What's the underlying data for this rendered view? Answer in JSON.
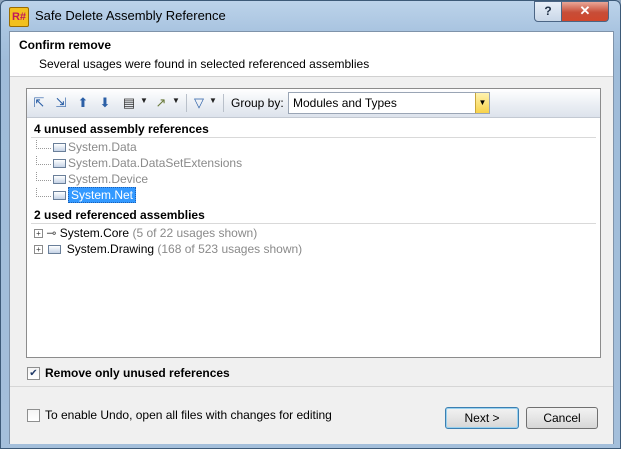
{
  "window": {
    "title": "Safe Delete Assembly Reference",
    "app_icon_text": "R#",
    "help_label": "?",
    "close_label": "✕"
  },
  "header": {
    "title": "Confirm remove",
    "subtitle": "Several usages were found in selected referenced assemblies"
  },
  "toolbar": {
    "icons": [
      "collapse-all-icon",
      "expand-all-icon",
      "previous-usage-icon",
      "next-usage-icon",
      "view-options-icon",
      "export-icon",
      "filter-icon"
    ],
    "group_by_label": "Group by:",
    "group_by_value": "Modules and Types"
  },
  "tree": {
    "unused_header": "4 unused assembly references",
    "unused": [
      "System.Data",
      "System.Data.DataSetExtensions",
      "System.Device",
      "System.Net"
    ],
    "used_header": "2 used referenced assemblies",
    "used": [
      {
        "name": "System.Core",
        "count": "(5 of 22 usages shown)"
      },
      {
        "name": "System.Drawing",
        "count": "(168 of 523 usages shown)"
      }
    ]
  },
  "options": {
    "remove_only_unused": "Remove only unused references",
    "remove_only_unused_checked": true,
    "enable_undo": "To enable Undo, open all files with changes for editing",
    "enable_undo_checked": false
  },
  "buttons": {
    "next": "Next >",
    "cancel": "Cancel"
  },
  "colors": {
    "selection": "#3399ff",
    "title_bar": "#a9c4e0",
    "close": "#c74d37"
  }
}
